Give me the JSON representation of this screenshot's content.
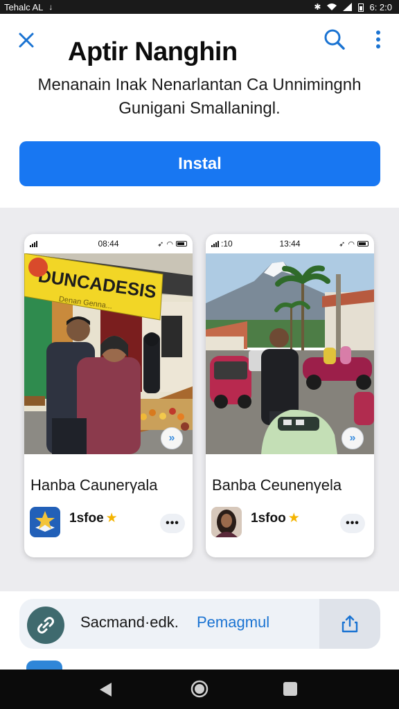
{
  "status_bar": {
    "carrier": "Tehalc AL",
    "time": "6: 2:0"
  },
  "header": {
    "title": "Aptir Nanghin"
  },
  "description": "Menanain Inak Nenarlantan Ca Unnimingnh Gunigani Smallaningl.",
  "install_button": {
    "label": "Instal"
  },
  "cards": [
    {
      "screenshot_time": "08:44",
      "banner_text": "DUNCADESIS",
      "banner_subtext": "Denan Genna...",
      "title": "Hanba Caunerγala",
      "rating": "1sfoe",
      "more_label": "•••"
    },
    {
      "screenshot_time": "13:44",
      "screenshot_signal_label": ":10",
      "title": "Banba Ceunenγela",
      "rating": "1sfoo",
      "more_label": "•••"
    }
  ],
  "share_bar": {
    "label": "Sacmand·edk.",
    "link_label": "Pemagmul"
  },
  "colors": {
    "accent": "#1877f2",
    "link": "#1a73d2",
    "star": "#f4b400"
  }
}
